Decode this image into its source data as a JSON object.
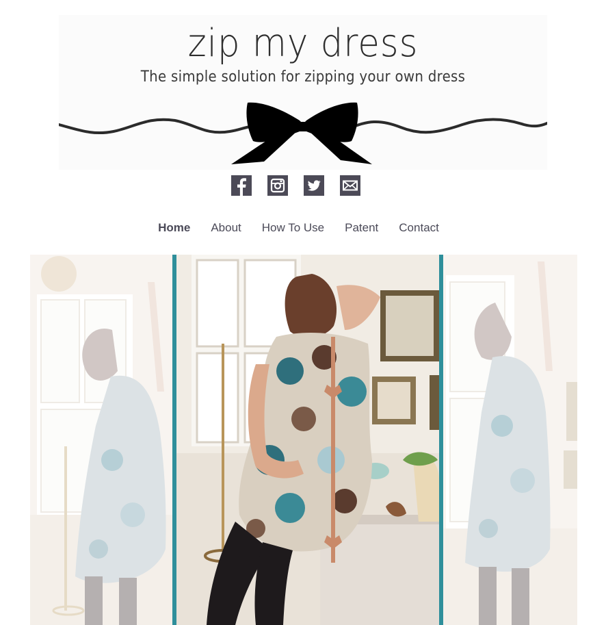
{
  "header": {
    "title": "zip my dress",
    "tagline": "The simple solution for zipping your own dress"
  },
  "social": [
    {
      "icon": "facebook-icon"
    },
    {
      "icon": "instagram-icon"
    },
    {
      "icon": "twitter-icon"
    },
    {
      "icon": "email-icon"
    }
  ],
  "nav": {
    "items": [
      {
        "label": "Home"
      },
      {
        "label": "About"
      },
      {
        "label": "How To Use"
      },
      {
        "label": "Patent"
      },
      {
        "label": "Contact"
      }
    ]
  },
  "colors": {
    "nav_text": "#4b4a58",
    "icon_bg": "#4c4a57",
    "hero_divider": "#2f8f9b"
  }
}
